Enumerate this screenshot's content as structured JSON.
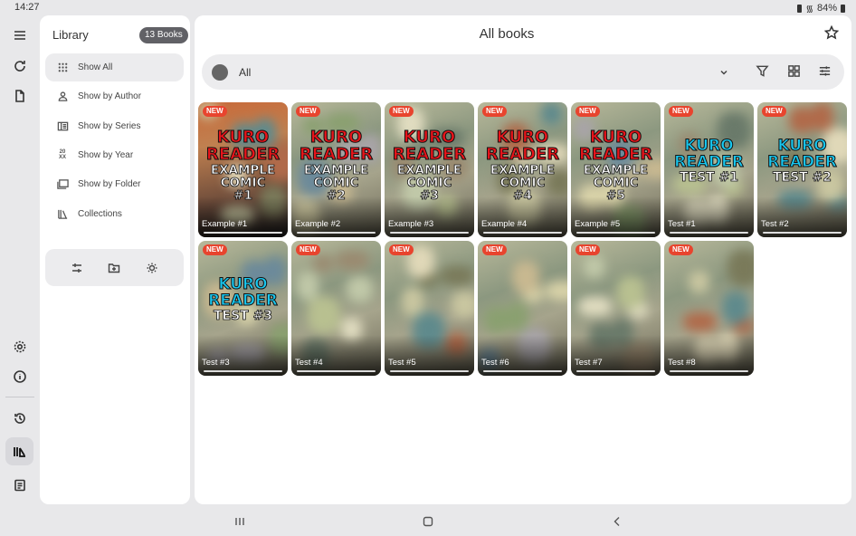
{
  "status": {
    "time": "14:27",
    "battery": "84%"
  },
  "rail": {
    "items": [
      {
        "name": "menu-icon"
      },
      {
        "name": "refresh-icon"
      },
      {
        "name": "document-icon"
      },
      {
        "name": "settings-icon"
      },
      {
        "name": "info-icon"
      },
      {
        "name": "history-icon"
      },
      {
        "name": "library-icon",
        "active": true
      },
      {
        "name": "notes-icon"
      }
    ]
  },
  "library": {
    "title": "Library",
    "badge": "13 Books",
    "items": [
      {
        "label": "Show All",
        "icon": "grid-dots-icon",
        "active": true
      },
      {
        "label": "Show by Author",
        "icon": "person-icon"
      },
      {
        "label": "Show by Series",
        "icon": "series-icon"
      },
      {
        "label": "Show by Year",
        "icon": "year-icon"
      },
      {
        "label": "Show by Folder",
        "icon": "folder-icon"
      },
      {
        "label": "Collections",
        "icon": "collections-icon"
      }
    ],
    "tools": [
      "sliders-icon",
      "add-folder-icon",
      "brightness-icon"
    ]
  },
  "main": {
    "title": "All books",
    "filter": {
      "value": "All"
    },
    "actions": [
      "filter-icon",
      "grid-view-icon",
      "tune-icon"
    ]
  },
  "books": [
    {
      "title": "Example #1",
      "badge": "NEW",
      "cover": {
        "style": "red",
        "l1": [
          "KURO",
          "READER"
        ],
        "l2": [
          "EXAMPLE",
          "COMIC",
          "#1"
        ]
      }
    },
    {
      "title": "Example #2",
      "badge": "NEW",
      "cover": {
        "style": "red",
        "l1": [
          "KURO",
          "READER"
        ],
        "l2": [
          "EXAMPLE",
          "COMIC",
          "#2"
        ]
      }
    },
    {
      "title": "Example #3",
      "badge": "NEW",
      "cover": {
        "style": "red",
        "l1": [
          "KURO",
          "READER"
        ],
        "l2": [
          "EXAMPLE",
          "COMIC",
          "#3"
        ]
      }
    },
    {
      "title": "Example #4",
      "badge": "NEW",
      "cover": {
        "style": "red",
        "l1": [
          "KURO",
          "READER"
        ],
        "l2": [
          "EXAMPLE",
          "COMIC",
          "#4"
        ]
      }
    },
    {
      "title": "Example #5",
      "badge": "NEW",
      "cover": {
        "style": "red",
        "l1": [
          "KURO",
          "READER"
        ],
        "l2": [
          "EXAMPLE",
          "COMIC",
          "#5"
        ]
      }
    },
    {
      "title": "Test #1",
      "badge": "NEW",
      "cover": {
        "style": "cyan",
        "l1": [
          "KURO",
          "READER"
        ],
        "l2": [
          "TEST #1"
        ]
      }
    },
    {
      "title": "Test #2",
      "badge": "NEW",
      "cover": {
        "style": "cyan",
        "l1": [
          "KURO",
          "READER"
        ],
        "l2": [
          "TEST #2"
        ]
      }
    },
    {
      "title": "Test #3",
      "badge": "NEW",
      "cover": {
        "style": "cyan",
        "l1": [
          "KURO",
          "READER"
        ],
        "l2": [
          "TEST #3"
        ]
      }
    },
    {
      "title": "Test #4",
      "badge": "NEW",
      "cover": null
    },
    {
      "title": "Test #5",
      "badge": "NEW",
      "cover": null
    },
    {
      "title": "Test #6",
      "badge": "NEW",
      "cover": null
    },
    {
      "title": "Test #7",
      "badge": "NEW",
      "cover": null
    },
    {
      "title": "Test #8",
      "badge": "NEW",
      "cover": null
    }
  ],
  "navbar": [
    "recents-icon",
    "home-icon",
    "back-icon"
  ]
}
